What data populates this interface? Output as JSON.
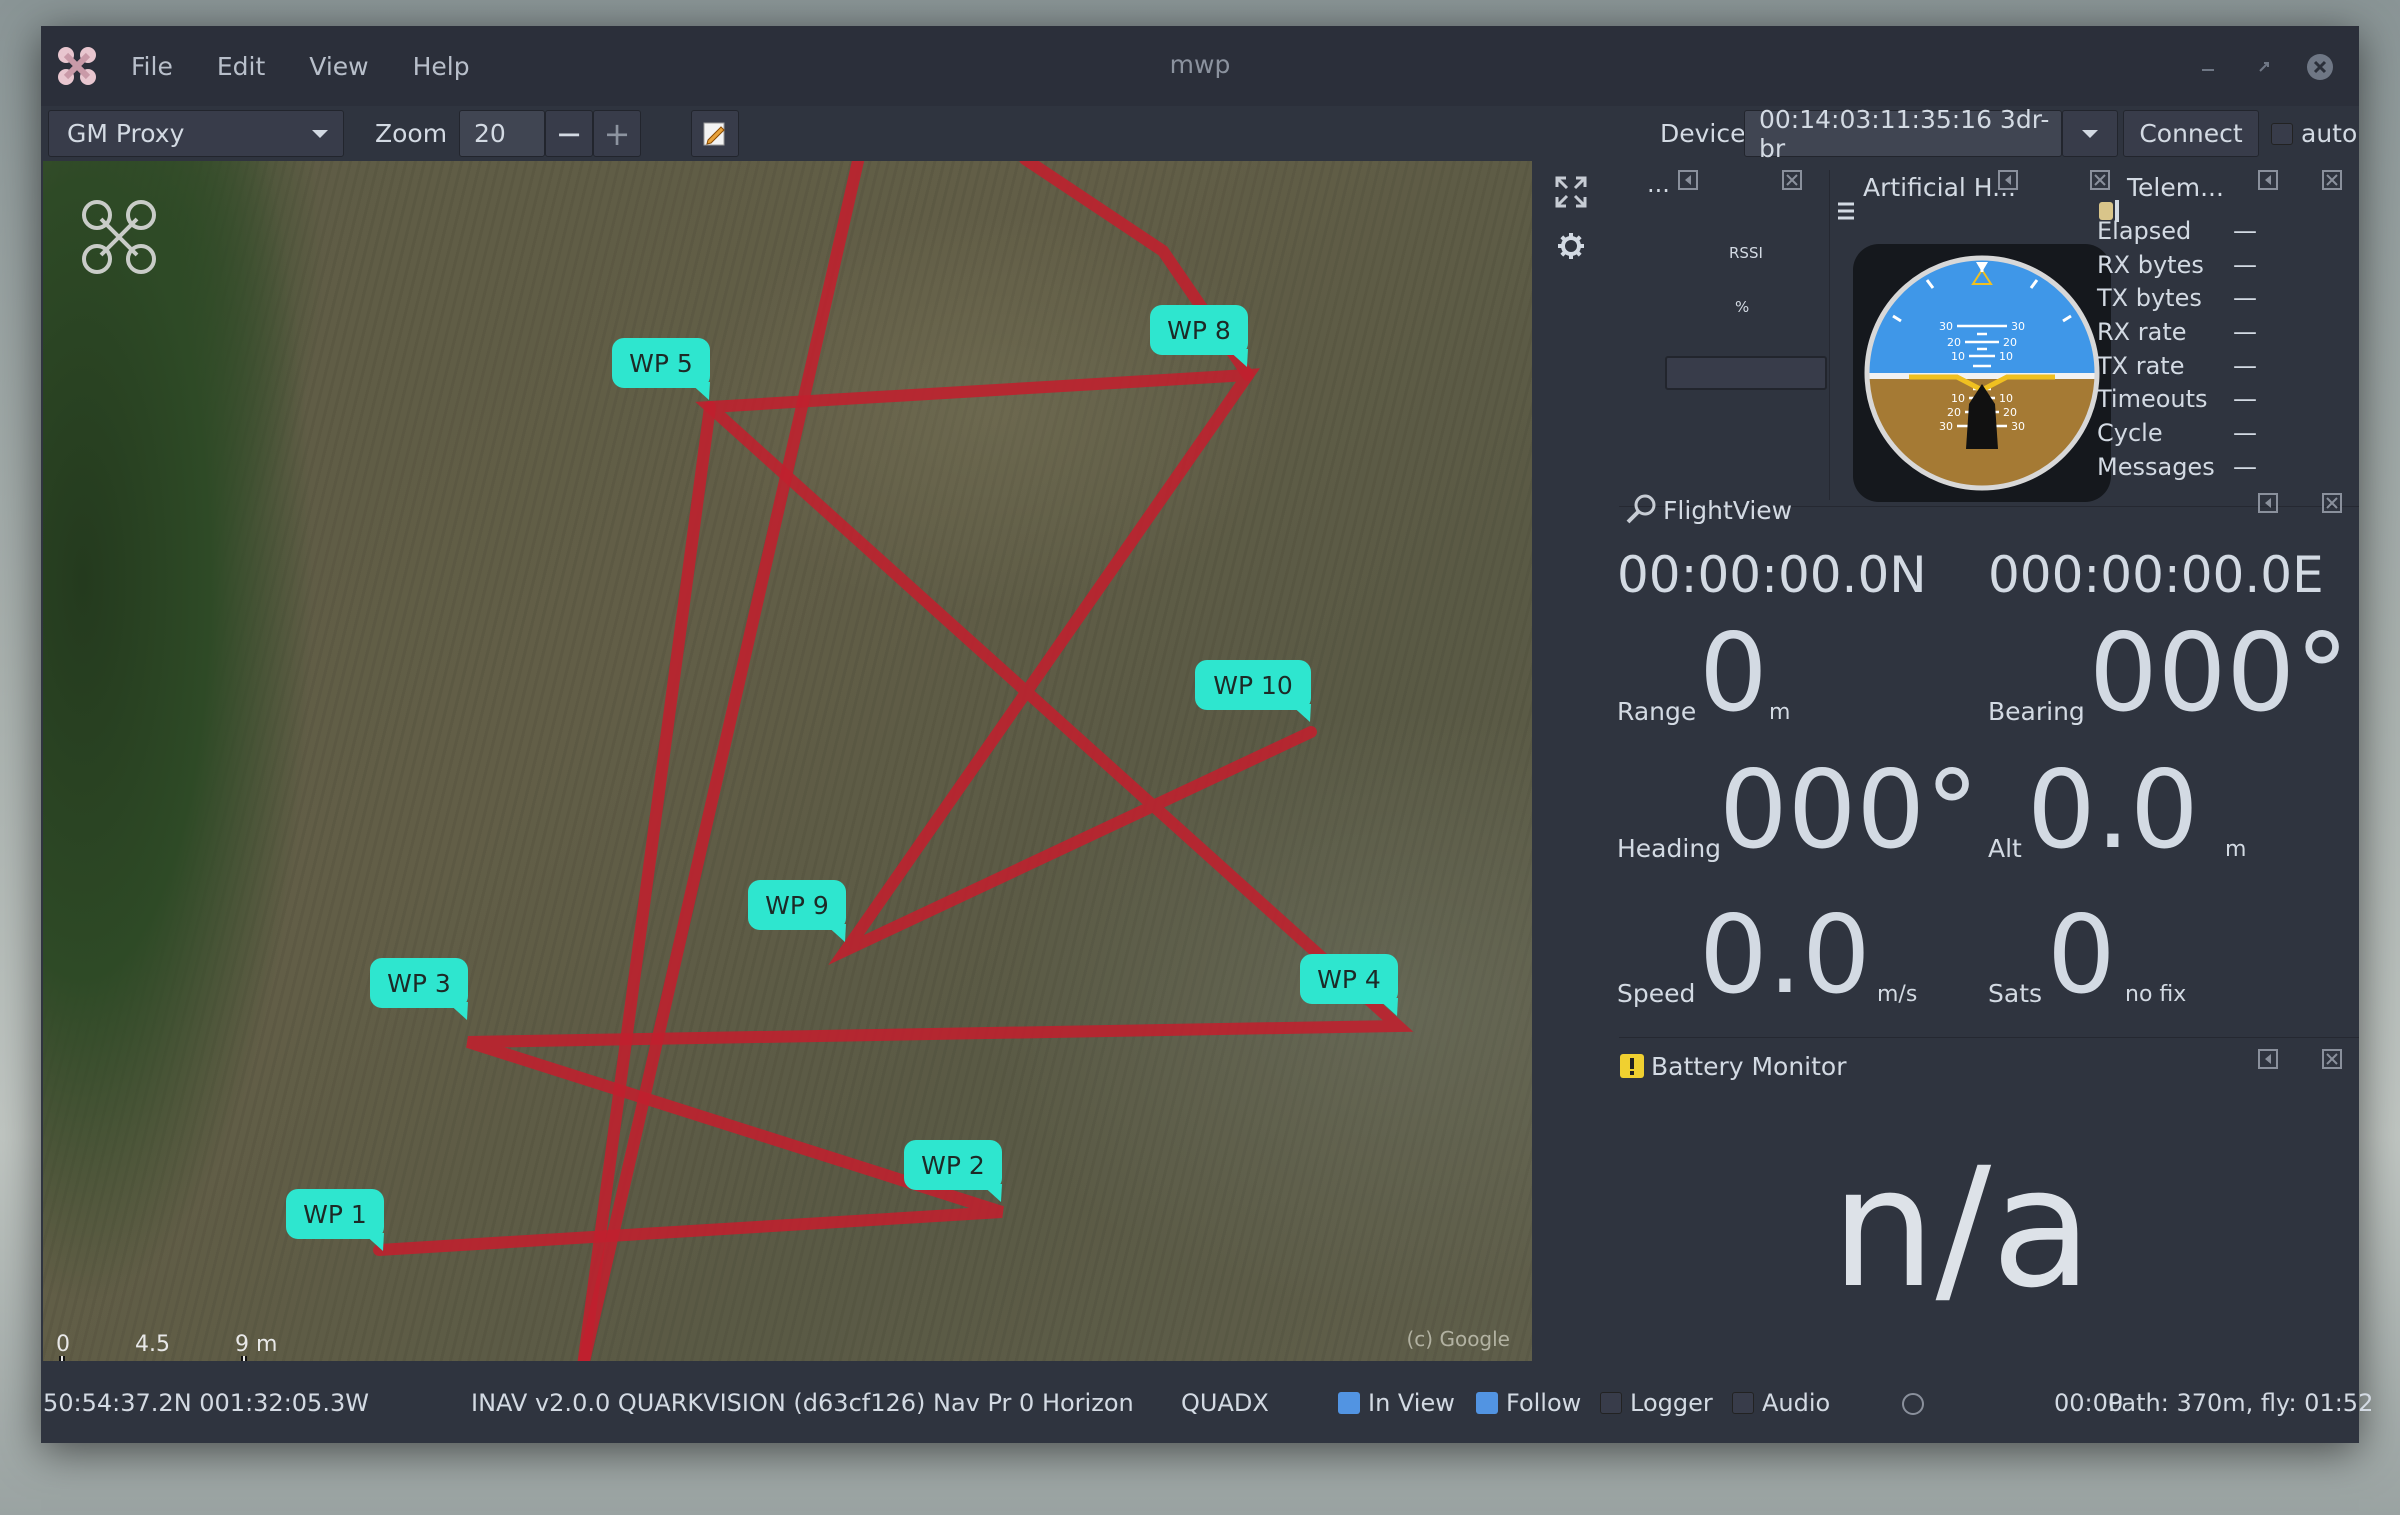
{
  "window": {
    "title": "mwp"
  },
  "menu": [
    "File",
    "Edit",
    "View",
    "Help"
  ],
  "toolbar": {
    "map_source": "GM Proxy",
    "zoom_label": "Zoom",
    "zoom_value": "20",
    "zoom_out": "−",
    "zoom_in": "+",
    "device_label": "Device",
    "device_value": "00:14:03:11:35:16 3dr-br",
    "connect_label": "Connect",
    "auto_label": "auto"
  },
  "map": {
    "waypoints": [
      "WP 1",
      "WP 2",
      "WP 3",
      "WP 4",
      "WP 5",
      "WP 8",
      "WP 9",
      "WP 10"
    ],
    "scale": {
      "labels": [
        "0",
        "4.5",
        "9 m"
      ]
    },
    "copyright": "(c) Google"
  },
  "panels": {
    "rssi": {
      "title": "...",
      "rssi_label": "RSSI",
      "percent_label": "%"
    },
    "horizon": {
      "title": "Artificial H...",
      "pitch_marks": [
        "30",
        "20",
        "10",
        "10",
        "20",
        "30"
      ]
    },
    "telemetry": {
      "title": "Telem...",
      "rows": [
        {
          "label": "Elapsed",
          "value": "—"
        },
        {
          "label": "RX bytes",
          "value": "—"
        },
        {
          "label": "TX bytes",
          "value": "—"
        },
        {
          "label": "RX rate",
          "value": "—"
        },
        {
          "label": "TX rate",
          "value": "—"
        },
        {
          "label": "Timeouts",
          "value": "—"
        },
        {
          "label": "Cycle",
          "value": "—"
        },
        {
          "label": "Messages",
          "value": "—"
        }
      ]
    },
    "flightview": {
      "title": "FlightView",
      "lat": "00:00:00.0N",
      "lon": "000:00:00.0E",
      "range_label": "Range",
      "range_value": "0",
      "range_unit": "m",
      "bearing_label": "Bearing",
      "bearing_value": "000°",
      "heading_label": "Heading",
      "heading_value": "000°",
      "alt_label": "Alt",
      "alt_value": "0.0",
      "alt_unit": "m",
      "speed_label": "Speed",
      "speed_value": "0.0",
      "speed_unit": "m/s",
      "sats_label": "Sats",
      "sats_value": "0",
      "sats_unit": "no fix"
    },
    "battery": {
      "title": "Battery Monitor",
      "value": "n/a"
    }
  },
  "status": {
    "position": "50:54:37.2N 001:32:05.3W",
    "fc_info": "INAV v2.0.0  QUARKVISION (d63cf126) Nav Pr 0 Horizon",
    "frame": "QUADX",
    "in_view": {
      "label": "In View",
      "checked": true
    },
    "follow": {
      "label": "Follow",
      "checked": true
    },
    "logger": {
      "label": "Logger",
      "checked": false
    },
    "audio": {
      "label": "Audio",
      "checked": false
    },
    "time": "00:00",
    "path": "Path: 370m, fly: 01:52"
  },
  "colors": {
    "route": "#c0202e",
    "marker": "#2ee6cf",
    "accent": "#5294e2"
  }
}
